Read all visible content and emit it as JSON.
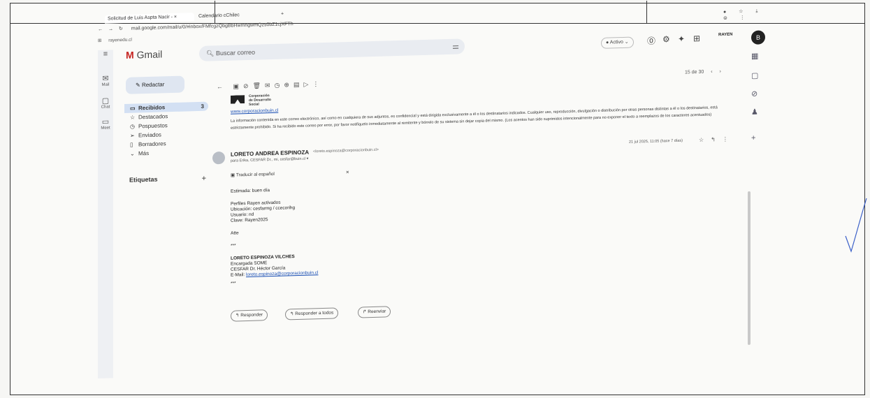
{
  "browser": {
    "tabs": [
      {
        "label": "Solicitud de Luis Aspta Nacir - ×",
        "active": true
      },
      {
        "label": "Calendario cChilec",
        "active": false
      }
    ],
    "new_tab": "+",
    "window_controls": "- ▫ ×",
    "url": "mail.google.com/mail/u/0/#inbox/FMfcgzQbgBbHwmhgwmQzs0bZ1cjXFTh",
    "bookmark": "rayenedu.cl"
  },
  "gmail": {
    "logo": "Gmail",
    "search_placeholder": "Buscar correo",
    "status": "Activo",
    "avatar_letter": "B",
    "brand_badge": "RAYEN"
  },
  "rail": [
    {
      "icon": "mail-icon",
      "label": "Mail"
    },
    {
      "icon": "chat-icon",
      "label": "Chat"
    },
    {
      "icon": "meet-icon",
      "label": "Meet"
    }
  ],
  "sidebar": {
    "compose": "Redactar",
    "items": [
      {
        "label": "Recibidos",
        "count": "3",
        "selected": true,
        "icon": "▭"
      },
      {
        "label": "Destacados",
        "count": "",
        "selected": false,
        "icon": "☆"
      },
      {
        "label": "Pospuestos",
        "count": "",
        "selected": false,
        "icon": "◷"
      },
      {
        "label": "Enviados",
        "count": "",
        "selected": false,
        "icon": "➢"
      },
      {
        "label": "Borradores",
        "count": "",
        "selected": false,
        "icon": "▯"
      },
      {
        "label": "Más",
        "count": "",
        "selected": false,
        "icon": "⌄"
      }
    ],
    "labels_title": "Etiquetas"
  },
  "pager": "15 de 30",
  "email": {
    "corp_name": "Corporación de Desarrollo Social",
    "corp_link": "www.corporacionbuin.cl",
    "disclaimer": "La información contenida en este correo electrónico, así como en cualquiera de sus adjuntos, es confidencial y está dirigida exclusivamente a él o los destinatarios indicados. Cualquier uso, reproducción, divulgación o distribución por otras personas distintas a él o los destinatarios, está estrictamente prohibido. Si ha recibido este correo por error, por favor notifíquelo inmediatamente al remitente y bórrelo de su sistema sin dejar copia del mismo. (Los acentos han sido suprimidos intencionalmente para no exponer el texto a reemplazos de los caracteres acentuados)",
    "sender_name": "LORETO ANDREA ESPINOZA",
    "sender_email": "<loreto.espinoza@corporacionbuin.cl>",
    "to_line": "para Erika, CESFAR Dr., mi, cesfar@buin.cl",
    "date": "21 jul 2025, 11:05 (hace 7 días)",
    "translate": "Traducir al español",
    "greeting": "Estimada: buen día",
    "line1": "Perfiles Rayen activados",
    "line2": "Ubicación: cesfarmg / ccecorihg",
    "line3": "Usuario: nd",
    "line4": "Clave: Rayen2025",
    "sign_off": "Atte",
    "ellipsis1": "***",
    "sig_name": "LORETO ESPINOZA VILCHES",
    "sig_role": "Encargada SOME",
    "sig_org": "CESFAR Dr. Héctor García",
    "sig_mail_label": "E-Mail:",
    "sig_mail": "loreto.espinoza@corporacionbuin.cl",
    "ellipsis2": "***",
    "reply": "Responder",
    "reply_all": "Responder a todos",
    "forward": "Reenviar"
  }
}
